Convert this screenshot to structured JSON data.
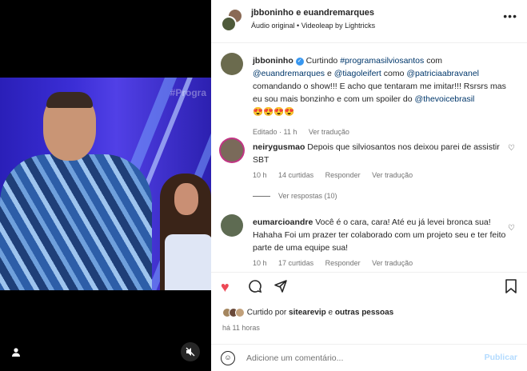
{
  "colors": {
    "accent": "#0095f6",
    "like": "#ed4956",
    "link": "#00376b",
    "muted": "#737373"
  },
  "header": {
    "title": "jbboninho e euandremarques",
    "subtitle": "Áudio original • Videoleap by Lightricks"
  },
  "media": {
    "watermark": "#Progra"
  },
  "caption": {
    "user": "jbboninho",
    "pre": "Curtindo",
    "tag1": "#programasilviosantos",
    "mid1": "com",
    "tag2": "@euandremarques",
    "mid2": "e",
    "tag3": "@tiagoleifert",
    "mid3": "como",
    "tag4": "@patriciaabravanel",
    "mid4": "comandando o show!!! E acho que tentaram me imitar!!! Rsrsrs mas eu sou mais bonzinho e com um spoiler do",
    "tag5": "@thevoicebrasil",
    "emojis": "😍😍😍😍",
    "meta_edit": "Editado · 11 h",
    "meta_translate": "Ver tradução"
  },
  "comments": [
    {
      "user": "neirygusmao",
      "text": "Depois que silviosantos nos deixou parei de assistir SBT",
      "time": "10 h",
      "likes": "14 curtidas",
      "reply": "Responder",
      "translate": "Ver tradução"
    },
    {
      "user": "eumarcioandre",
      "text": "Você é o cara, cara! Até eu já levei bronca sua! Hahaha Foi um prazer ter colaborado com um projeto seu e ter feito parte de uma equipe sua!",
      "time": "10 h",
      "likes": "17 curtidas",
      "reply": "Responder",
      "translate": "Ver tradução"
    }
  ],
  "replies_link": "Ver respostas (10)",
  "liked_by": {
    "pre": "Curtido por",
    "user": "sitearevip",
    "mid": "e",
    "others": "outras pessoas"
  },
  "timestamp": "há 11 horas",
  "add_comment": {
    "placeholder": "Adicione um comentário...",
    "publish": "Publicar"
  }
}
